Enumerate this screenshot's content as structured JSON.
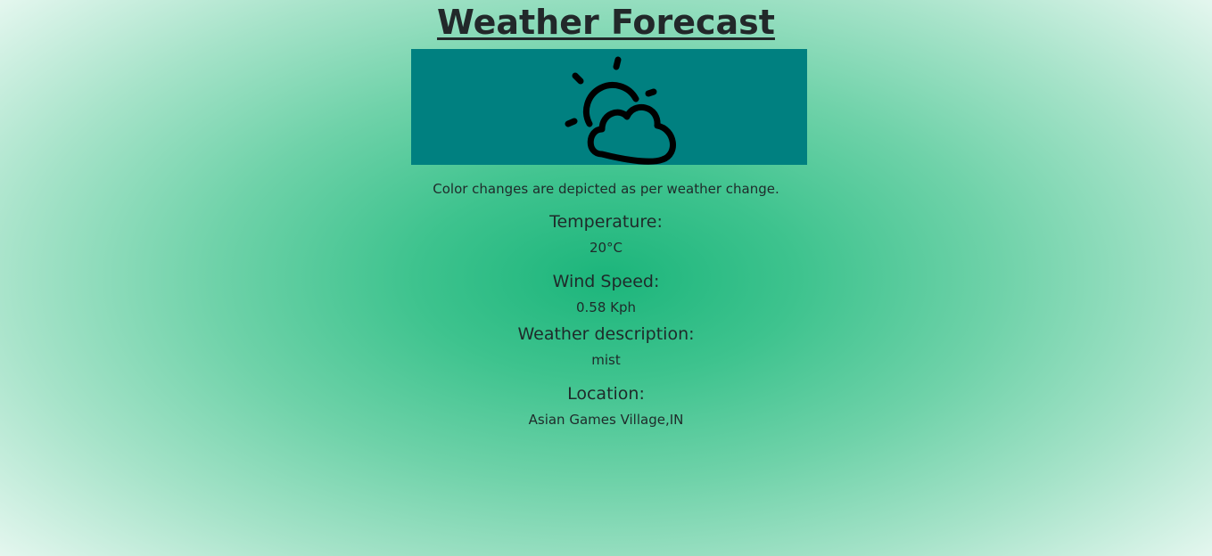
{
  "header": {
    "title": "Weather Forecast"
  },
  "banner": {
    "background": "#008080",
    "icon": "partly-cloudy-icon"
  },
  "note": "Color changes are depicted as per weather change.",
  "details": {
    "temperature_label": "Temperature:",
    "temperature_value": "20°C",
    "wind_label": "Wind Speed:",
    "wind_value": "0.58 Kph",
    "description_label": "Weather description:",
    "description_value": "mist",
    "location_label": "Location:",
    "location_value": "Asian Games Village,IN"
  },
  "colors": {
    "center": "#1cb57b",
    "edge": "#f7fdfa",
    "text": "#1f2a2a"
  }
}
